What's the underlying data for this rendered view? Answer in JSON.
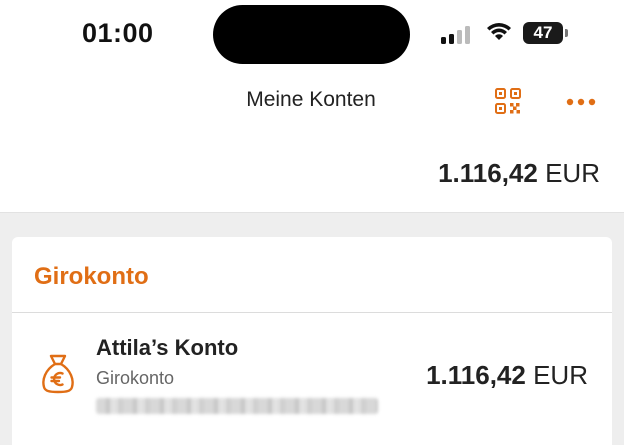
{
  "status_bar": {
    "time": "01:00",
    "battery": "47"
  },
  "nav": {
    "title": "Meine Konten",
    "qr_icon": "qr-code-icon",
    "more_icon": "more-dots-icon"
  },
  "summary": {
    "total_amount": "1.116,42",
    "currency": "EUR"
  },
  "sections": [
    {
      "title": "Girokonto",
      "accounts": [
        {
          "name": "Attila’s Konto",
          "type": "Girokonto",
          "amount": "1.116,42",
          "currency": "EUR",
          "icon": "money-bag-euro-icon"
        }
      ]
    }
  ],
  "colors": {
    "accent": "#e06e15",
    "background": "#eeeeee"
  }
}
